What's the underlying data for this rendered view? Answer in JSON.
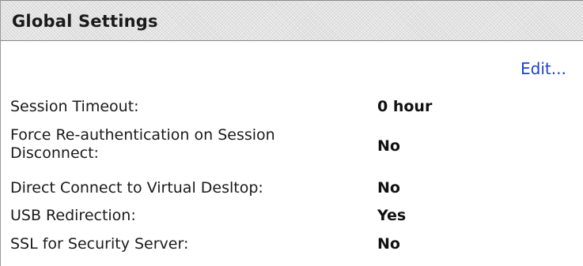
{
  "panel": {
    "title": "Global Settings",
    "edit_label": "Edit..."
  },
  "settings": [
    {
      "label": "Session Timeout:",
      "value": "0 hour"
    },
    {
      "label": "Force Re-authentication on Session Disconnect:",
      "value": "No"
    },
    {
      "label": "Direct Connect to Virtual Desltop:",
      "value": "No"
    },
    {
      "label": "USB Redirection:",
      "value": "Yes"
    },
    {
      "label": "SSL for Security Server:",
      "value": "No"
    }
  ],
  "colors": {
    "link": "#1a3fd4",
    "header_background": "#e2e2e2"
  }
}
